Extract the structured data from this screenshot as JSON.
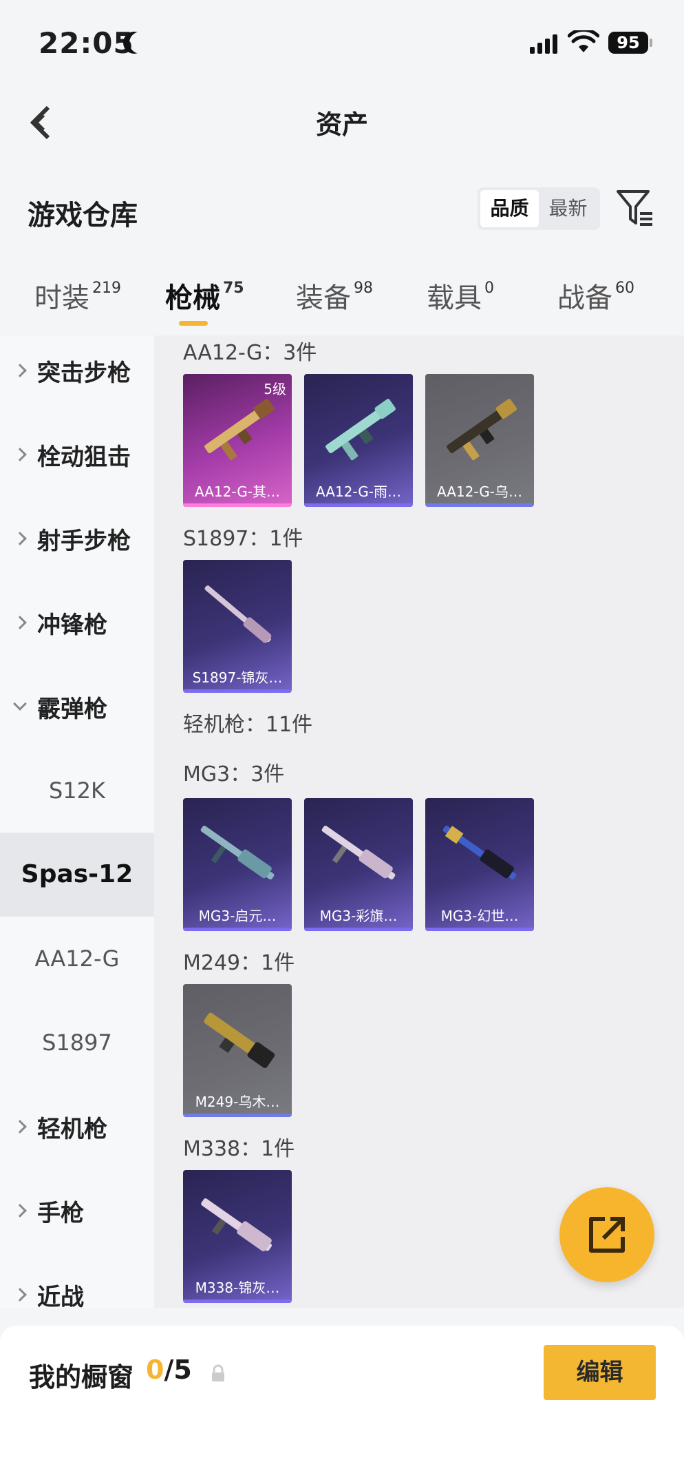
{
  "status_bar": {
    "time": "22:05",
    "battery": "95"
  },
  "header": {
    "title": "资产"
  },
  "warehouse": {
    "title": "游戏仓库",
    "sort_options": [
      "品质",
      "最新"
    ],
    "sort_selected": "品质"
  },
  "tabs": [
    {
      "label": "时装",
      "count": "219"
    },
    {
      "label": "枪械",
      "count": "75"
    },
    {
      "label": "装备",
      "count": "98"
    },
    {
      "label": "载具",
      "count": "0"
    },
    {
      "label": "战备",
      "count": "60"
    }
  ],
  "active_tab": "枪械",
  "sidebar": {
    "items": [
      {
        "label": "突击步枪"
      },
      {
        "label": "栓动狙击"
      },
      {
        "label": "射手步枪"
      },
      {
        "label": "冲锋枪"
      },
      {
        "label": "霰弹枪"
      }
    ],
    "sub_items": [
      "S12K",
      "Spas-12",
      "AA12-G",
      "S1897"
    ],
    "active_sub": "Spas-12",
    "more_items": [
      "轻机枪",
      "手枪",
      "近战"
    ]
  },
  "groups": {
    "aa12g": {
      "title": "AA12-G：3件",
      "cards": [
        {
          "name": "AA12-G-其…",
          "level": "5级",
          "rarity": "pink"
        },
        {
          "name": "AA12-G-雨…",
          "rarity": "purple"
        },
        {
          "name": "AA12-G-乌…",
          "rarity": "grey"
        }
      ]
    },
    "s1897": {
      "title": "S1897：1件",
      "cards": [
        {
          "name": "S1897-锦灰…",
          "rarity": "purple"
        }
      ]
    },
    "lmg": {
      "title": "轻机枪：11件"
    },
    "mg3": {
      "title": "MG3：3件",
      "cards": [
        {
          "name": "MG3-启元…",
          "rarity": "purple"
        },
        {
          "name": "MG3-彩旗…",
          "rarity": "purple"
        },
        {
          "name": "MG3-幻世…",
          "rarity": "purple"
        }
      ]
    },
    "m249": {
      "title": "M249：1件",
      "cards": [
        {
          "name": "M249-乌木…",
          "rarity": "grey"
        }
      ]
    },
    "m338": {
      "title": "M338：1件",
      "cards": [
        {
          "name": "M338-锦灰…",
          "rarity": "purple"
        }
      ]
    }
  },
  "bottom": {
    "showcase_label": "我的橱窗",
    "showcase_current": "0",
    "showcase_total": "/5",
    "edit_label": "编辑"
  },
  "colors": {
    "accent": "#f5b532",
    "purple_card": "#3d3478",
    "pink_card": "#a43ca9",
    "grey_card": "#6c6c72"
  }
}
